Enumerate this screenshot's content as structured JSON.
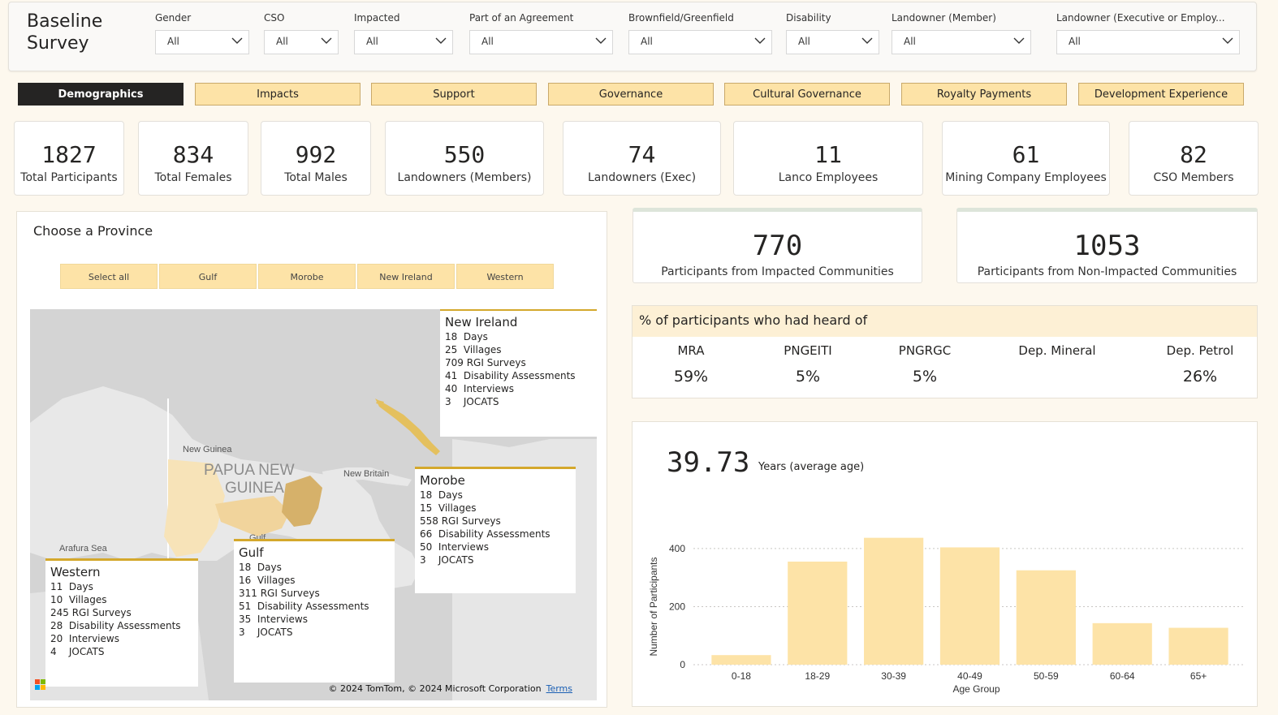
{
  "header": {
    "title_line1": "Baseline",
    "title_line2": "Survey",
    "filters": [
      {
        "label": "Gender",
        "value": "All"
      },
      {
        "label": "CSO",
        "value": "All"
      },
      {
        "label": "Impacted",
        "value": "All"
      },
      {
        "label": "Part of an Agreement",
        "value": "All"
      },
      {
        "label": "Brownfield/Greenfield",
        "value": "All"
      },
      {
        "label": "Disability",
        "value": "All"
      },
      {
        "label": "Landowner (Member)",
        "value": "All"
      },
      {
        "label": "Landowner (Executive or Employ...",
        "value": "All"
      }
    ]
  },
  "tabs": [
    "Demographics",
    "Impacts",
    "Support",
    "Governance",
    "Cultural Governance",
    "Royalty Payments",
    "Development Experience"
  ],
  "kpis": [
    {
      "value": "1827",
      "label": "Total Participants"
    },
    {
      "value": "834",
      "label": "Total Females"
    },
    {
      "value": "992",
      "label": "Total Males"
    },
    {
      "value": "550",
      "label": "Landowners (Members)"
    },
    {
      "value": "74",
      "label": "Landowners (Exec)"
    },
    {
      "value": "11",
      "label": "Lanco Employees"
    },
    {
      "value": "61",
      "label": "Mining Company Employees"
    },
    {
      "value": "82",
      "label": "CSO Members"
    }
  ],
  "province": {
    "title": "Choose a Province",
    "buttons": [
      "Select all",
      "Gulf",
      "Morobe",
      "New Ireland",
      "Western"
    ],
    "map_labels": {
      "country1": "PAPUA NEW",
      "country2": "GUINEA",
      "new_guinea": "New Guinea",
      "new_britain": "New Britain",
      "arafura": "Arafura Sea",
      "gulf": "Gulf"
    },
    "callouts": {
      "new_ireland": {
        "name": "New Ireland",
        "lines": [
          "18  Days",
          "25  Villages",
          "709 RGI Surveys",
          "41  Disability Assessments",
          "40  Interviews",
          "3    JOCATS"
        ]
      },
      "morobe": {
        "name": "Morobe",
        "lines": [
          "18  Days",
          "15  Villages",
          "558 RGI Surveys",
          "66  Disability Assessments",
          "50  Interviews",
          "3    JOCATS"
        ]
      },
      "gulf": {
        "name": "Gulf",
        "lines": [
          "18  Days",
          "16  Villages",
          "311 RGI Surveys",
          "51  Disability Assessments",
          "35  Interviews",
          "3    JOCATS"
        ]
      },
      "western": {
        "name": "Western",
        "lines": [
          "11  Days",
          "10  Villages",
          "245 RGI Surveys",
          "28  Disability Assessments",
          "20  Interviews",
          "4    JOCATS"
        ]
      }
    },
    "copyright": "© 2024 TomTom, © 2024 Microsoft Corporation",
    "terms": "Terms"
  },
  "participants": [
    {
      "value": "770",
      "label": "Participants from Impacted Communities"
    },
    {
      "value": "1053",
      "label": "Participants from Non-Impacted Communities"
    }
  ],
  "heard": {
    "title": "% of participants who had heard of",
    "items": [
      {
        "name": "MRA",
        "pct": "59%"
      },
      {
        "name": "PNGEITI",
        "pct": "5%"
      },
      {
        "name": "PNGRGC",
        "pct": "5%"
      },
      {
        "name": "Dep. Mineral",
        "pct": ""
      },
      {
        "name": "Dep. Petrol",
        "pct": "26%"
      }
    ]
  },
  "age": {
    "average": "39.73",
    "average_label": "Years (average age)"
  },
  "chart_data": {
    "type": "bar",
    "categories": [
      "0-18",
      "18-29",
      "30-39",
      "40-49",
      "50-59",
      "60-64",
      "65+"
    ],
    "values": [
      33,
      355,
      437,
      404,
      325,
      143,
      127
    ],
    "xlabel": "Age Group",
    "ylabel": "Number of Participants",
    "yticks": [
      0,
      200,
      400
    ],
    "ylim": [
      0,
      450
    ],
    "bar_color": "#fde3a7",
    "grid": true
  }
}
